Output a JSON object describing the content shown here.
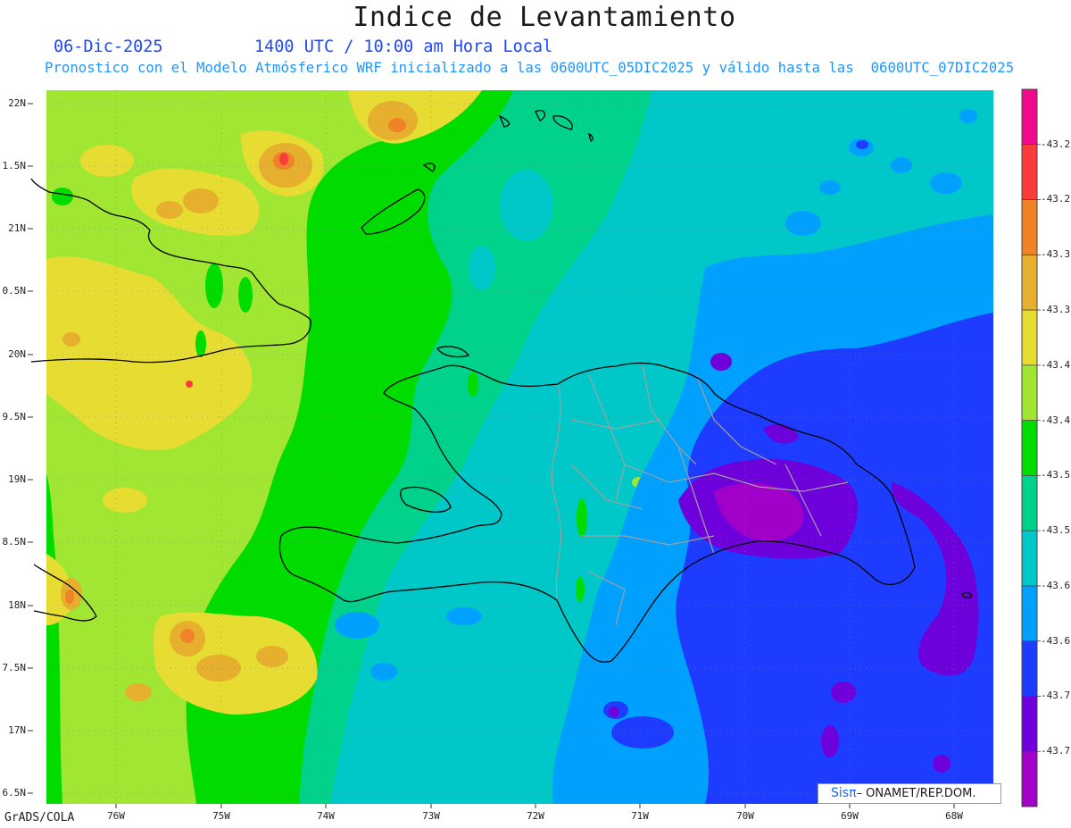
{
  "header": {
    "title": "Indice de Levantamiento",
    "date": "06-Dic-2025",
    "time": "1400 UTC / 10:00 am Hora Local",
    "subtitle": "Pronostico con el Modelo Atmósferico WRF inicializado a las 0600UTC_05DIC2025 y válido hasta las  0600UTC_07DIC2025",
    "text_colors": {
      "title": "#1a1a1a",
      "date": "#1e46ff",
      "subtitle": "#1e96ff"
    }
  },
  "axes": {
    "lat_labels": [
      "22N",
      "1.5N",
      "21N",
      "0.5N",
      "20N",
      "9.5N",
      "19N",
      "8.5N",
      "18N",
      "7.5N",
      "17N",
      "6.5N"
    ],
    "lon_labels": [
      "76W",
      "75W",
      "74W",
      "73W",
      "72W",
      "71W",
      "70W",
      "69W",
      "68W"
    ]
  },
  "colorbar": {
    "colors": [
      "#f00a8c",
      "#fa3c3c",
      "#f08228",
      "#e6af2d",
      "#e6dc32",
      "#a0e632",
      "#00dc00",
      "#00d28c",
      "#00c8c8",
      "#00a0ff",
      "#1e3cff",
      "#6e00dc",
      "#a000c8"
    ],
    "labels": [
      "-43.2",
      "-43.2",
      "-43.3",
      "-43.3",
      "-43.4",
      "-43.4",
      "-43.5",
      "-43.5",
      "-43.6",
      "-43.6",
      "-43.7",
      "-43.7"
    ]
  },
  "map": {
    "palette": {
      "pink": "#f00a8c",
      "red": "#fa3c3c",
      "orange": "#f08228",
      "gold": "#e6af2d",
      "yellow": "#e6dc32",
      "yellow_green": "#a0e632",
      "green": "#00dc00",
      "teal": "#00d28c",
      "cyan": "#00c8c8",
      "light_blue": "#00a0ff",
      "blue": "#1e3cff",
      "violet": "#6e00dc",
      "purple": "#a000c8",
      "coastline": "#000000",
      "border": "#a0a0a0"
    }
  },
  "footer": {
    "credit": "GrADS/COLA",
    "logo_prefix": "Sisπ",
    "logo_text": "– ONAMET/REP.DOM.",
    "logo_prefix_color": "#1e64ff"
  }
}
